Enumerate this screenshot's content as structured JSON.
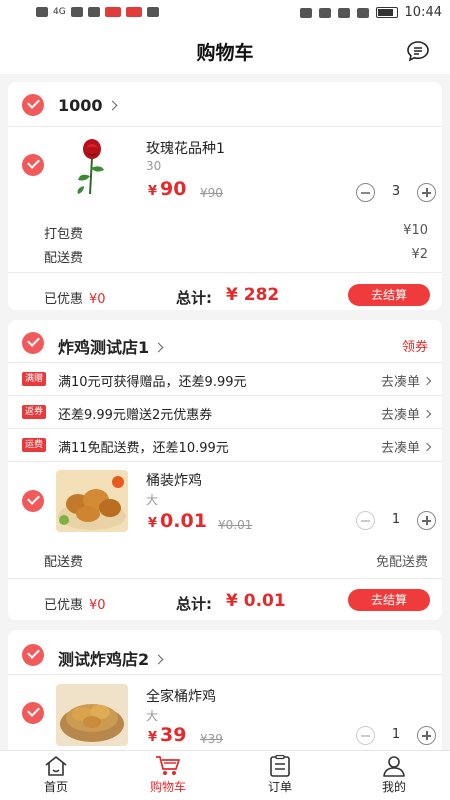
{
  "status": {
    "time": "10:44",
    "network": "4G"
  },
  "header": {
    "title": "购物车"
  },
  "colors": {
    "accent": "#e32b2b",
    "check": "#f05a5a"
  },
  "shops": [
    {
      "name": "1000",
      "items": [
        {
          "name": "玫瑰花品种1",
          "spec": "30",
          "yen": "¥",
          "price": "90",
          "orig": "¥90",
          "qty": "3",
          "icon": "rose-image"
        }
      ],
      "fees": [
        {
          "label": "打包费",
          "value": "¥10"
        },
        {
          "label": "配送费",
          "value": "¥2"
        }
      ],
      "discount_label": "已优惠",
      "discount_value": "¥0",
      "total_label": "总计:",
      "total_value": "¥ 282",
      "checkout": "去结算"
    },
    {
      "name": "炸鸡测试店1",
      "coupon": "领券",
      "promos": [
        {
          "tag": "满赠",
          "text": "满10元可获得赠品，还差9.99元",
          "link": "去凑单"
        },
        {
          "tag": "返券",
          "text": "还差9.99元赠送2元优惠券",
          "link": "去凑单"
        },
        {
          "tag": "运费",
          "text": "满11免配送费，还差10.99元",
          "link": "去凑单"
        }
      ],
      "items": [
        {
          "name": "桶装炸鸡",
          "spec": "大",
          "yen": "¥",
          "price": "0.01",
          "orig": "¥0.01",
          "qty": "1",
          "icon": "fried-chicken-image"
        }
      ],
      "fees": [
        {
          "label": "配送费",
          "value": "免配送费"
        }
      ],
      "discount_label": "已优惠",
      "discount_value": "¥0",
      "total_label": "总计:",
      "total_value": "¥ 0.01",
      "checkout": "去结算"
    },
    {
      "name": "测试炸鸡店2",
      "items": [
        {
          "name": "全家桶炸鸡",
          "spec": "大",
          "yen": "¥",
          "price": "39",
          "orig": "¥39",
          "qty": "1",
          "icon": "chicken-basket-image"
        }
      ]
    }
  ],
  "tabs": [
    {
      "label": "首页",
      "icon": "home-icon",
      "active": false
    },
    {
      "label": "购物车",
      "icon": "cart-icon",
      "active": true
    },
    {
      "label": "订单",
      "icon": "order-icon",
      "active": false
    },
    {
      "label": "我的",
      "icon": "user-icon",
      "active": false
    }
  ]
}
